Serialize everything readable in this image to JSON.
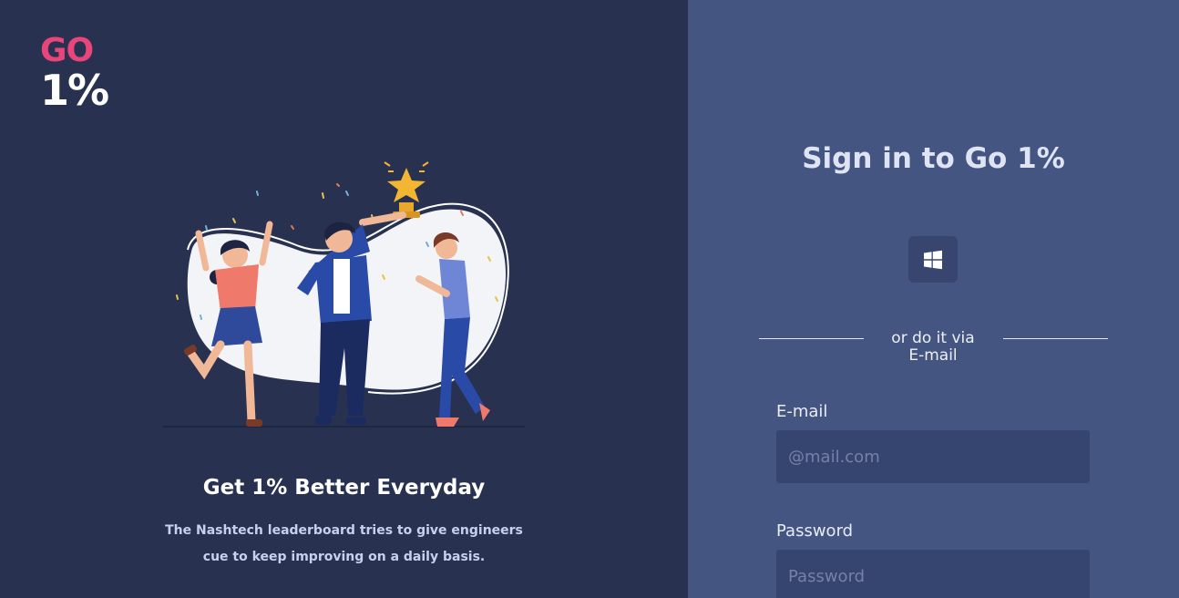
{
  "logo": {
    "line1": "GO",
    "line2": "1%"
  },
  "hero": {
    "tagline": "Get 1% Better Everyday",
    "description_line1": "The Nashtech leaderboard tries to give engineers",
    "description_line2": "cue to keep improving on a daily basis."
  },
  "signin": {
    "title": "Sign in to Go 1%",
    "microsoft_icon": "windows-icon",
    "divider_line1": "or do it via",
    "divider_line2": "E-mail",
    "email_label": "E-mail",
    "email_placeholder": "@mail.com",
    "email_value": "",
    "password_label": "Password",
    "password_placeholder": "Password",
    "password_value": ""
  },
  "colors": {
    "left_bg": "#283250",
    "right_bg": "#455581",
    "input_bg": "#364470",
    "accent_pink": "#e8457a"
  }
}
